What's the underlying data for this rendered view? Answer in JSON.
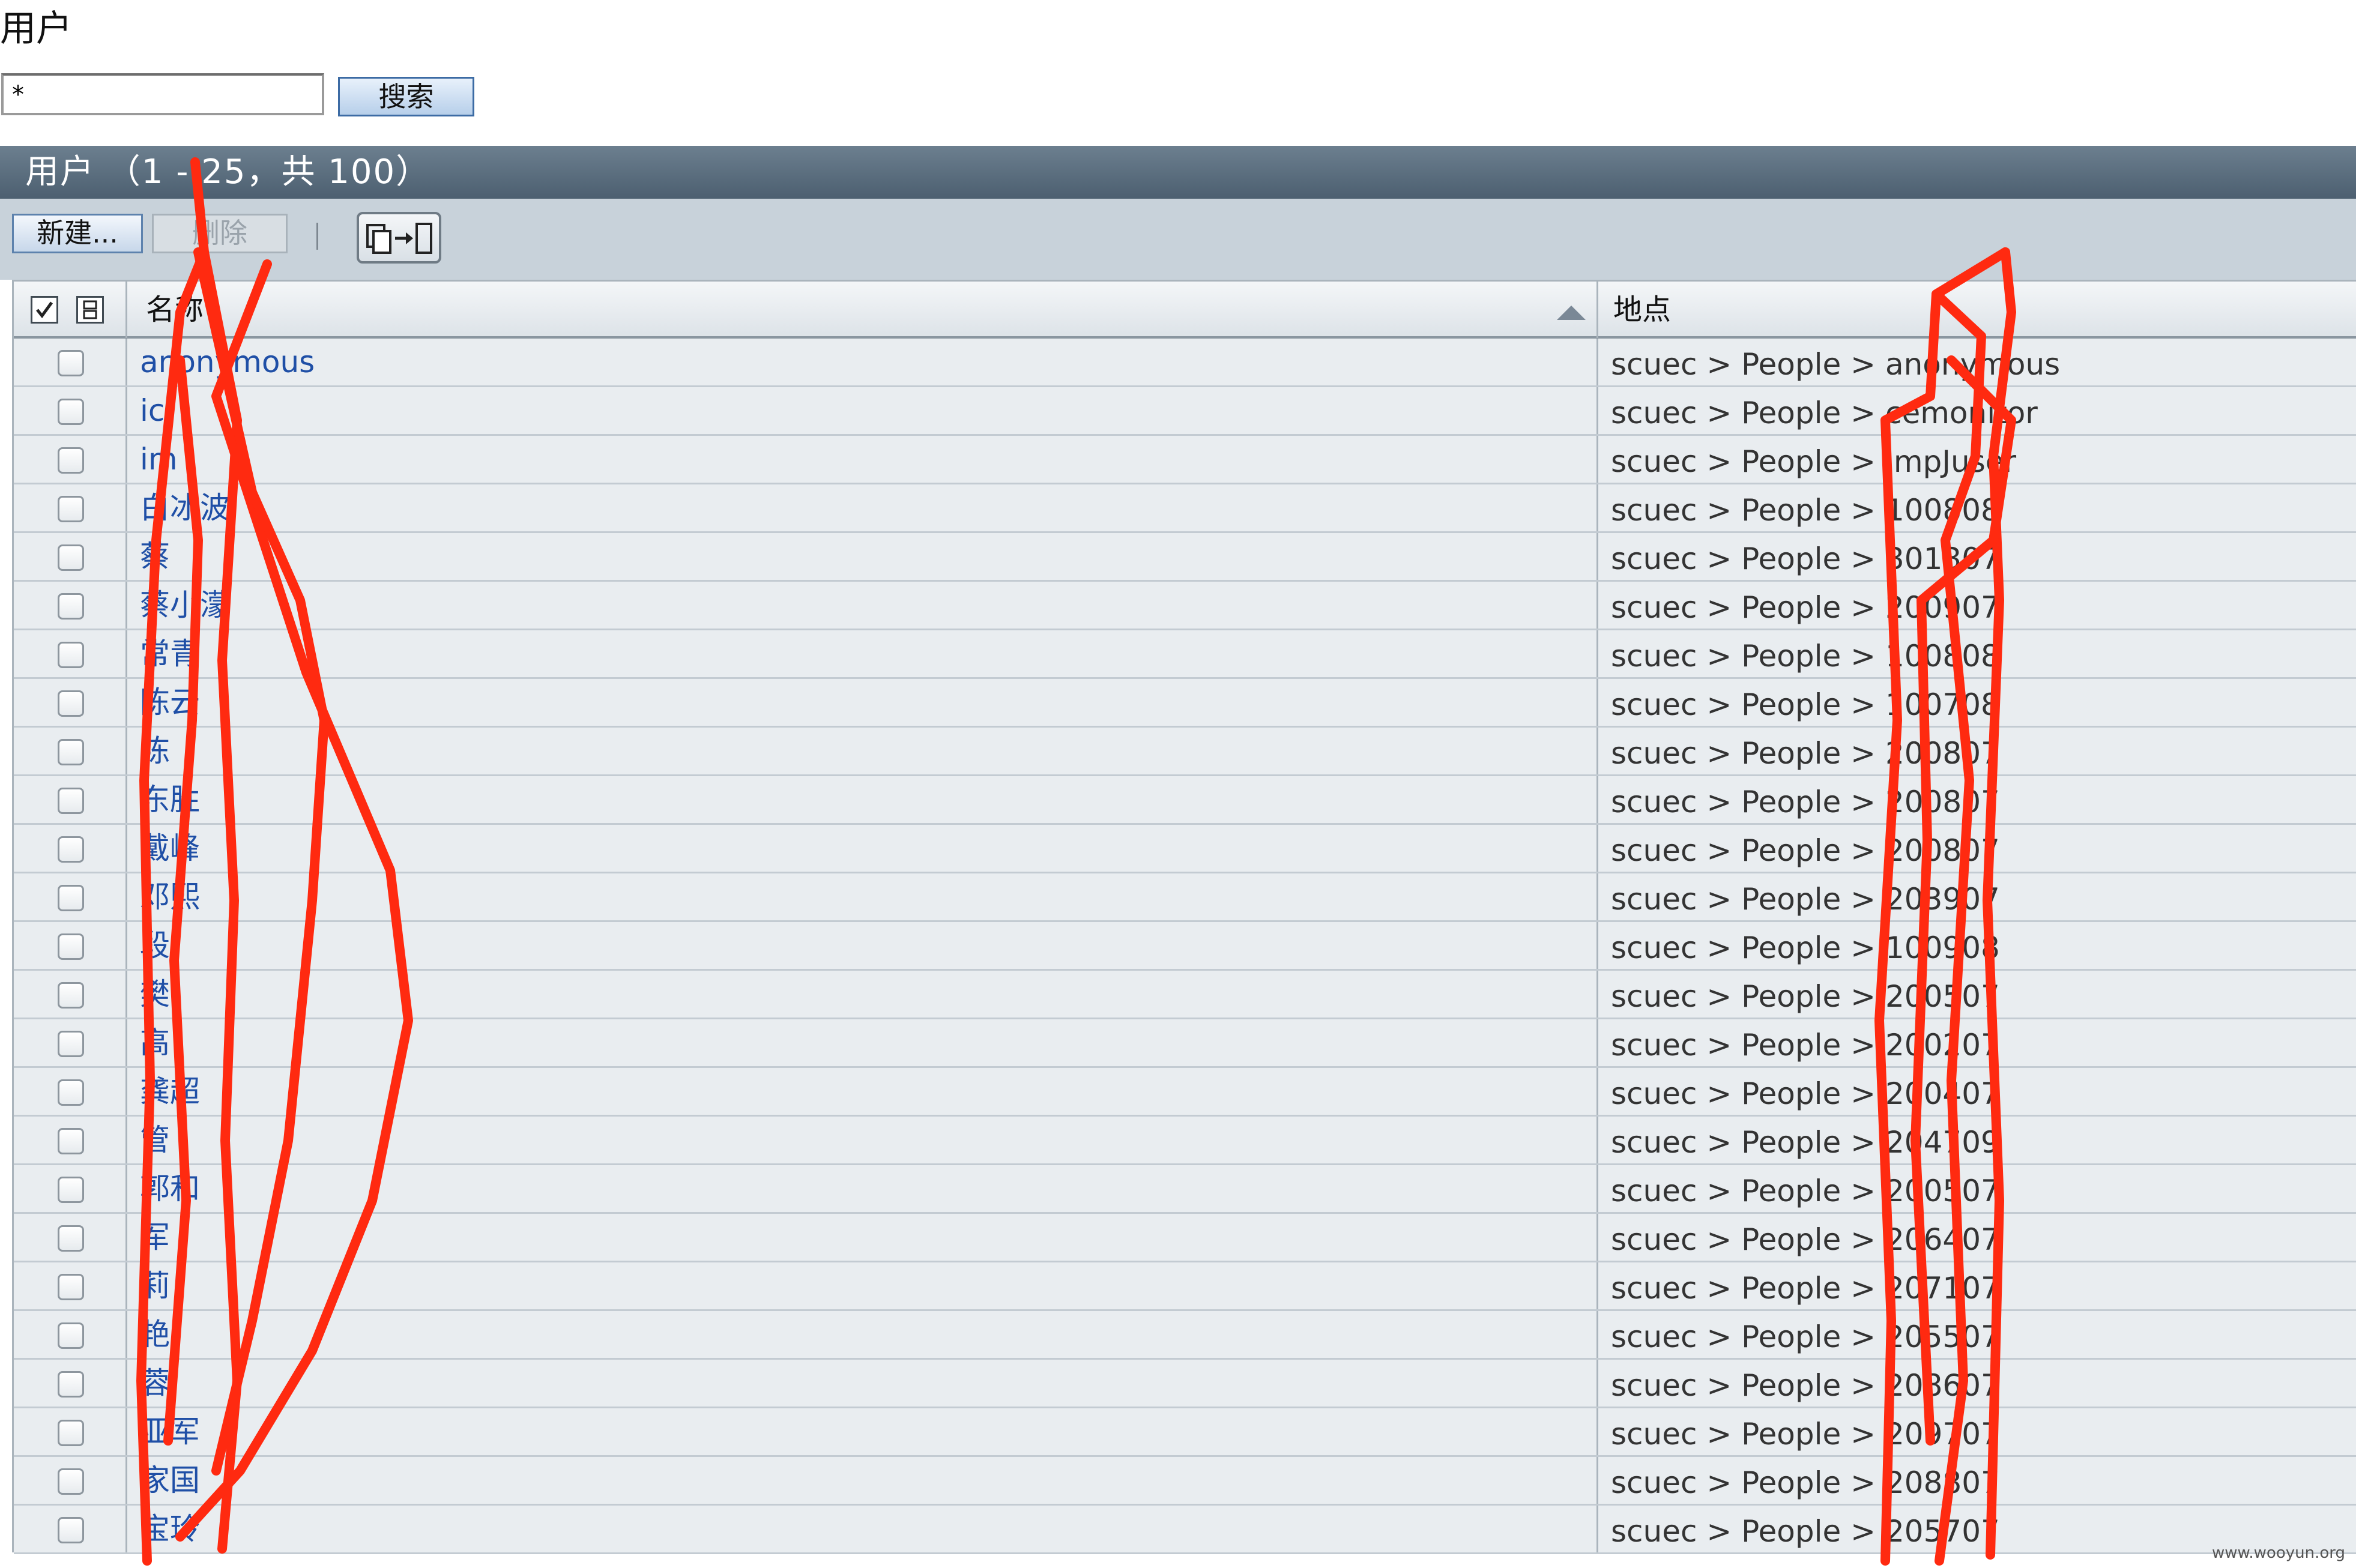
{
  "page": {
    "title": "用户"
  },
  "search": {
    "value": "*",
    "button_label": "搜索"
  },
  "panel": {
    "header": "用户 （1 - 25，共 100）"
  },
  "toolbar": {
    "new_label": "新建...",
    "delete_label": "删除",
    "move_icon": "copy-move-icon"
  },
  "grid": {
    "columns": {
      "name": "名称",
      "location": "地点"
    },
    "sort": {
      "column": "name",
      "direction": "ascending"
    },
    "rows": [
      {
        "name": "anonymous",
        "location": "scuec > People > anonymous"
      },
      {
        "name": "ic",
        "location": "scuec > People > cemonitor"
      },
      {
        "name": "im",
        "location": "scuec > People > impJuser"
      },
      {
        "name": "白冰波",
        "location": "scuec > People > 100808"
      },
      {
        "name": "蔡",
        "location": "scuec > People > 301307"
      },
      {
        "name": "蔡小濛",
        "location": "scuec > People > 200907"
      },
      {
        "name": "常青",
        "location": "scuec > People > 100808"
      },
      {
        "name": "陈云",
        "location": "scuec > People > 100708"
      },
      {
        "name": "陈",
        "location": "scuec > People > 200807"
      },
      {
        "name": "东胜",
        "location": "scuec > People > 200807"
      },
      {
        "name": "戴峰",
        "location": "scuec > People > 200807"
      },
      {
        "name": "邓熙",
        "location": "scuec > People > 203907"
      },
      {
        "name": "段",
        "location": "scuec > People > 100908"
      },
      {
        "name": "樊",
        "location": "scuec > People > 200507"
      },
      {
        "name": "高",
        "location": "scuec > People > 200207"
      },
      {
        "name": "龚超",
        "location": "scuec > People > 200407"
      },
      {
        "name": "管",
        "location": "scuec > People > 204709"
      },
      {
        "name": "郭和",
        "location": "scuec > People > 200507"
      },
      {
        "name": "军",
        "location": "scuec > People > 206407"
      },
      {
        "name": "莉",
        "location": "scuec > People > 207107"
      },
      {
        "name": "艳",
        "location": "scuec > People > 205507"
      },
      {
        "name": "蓉",
        "location": "scuec > People > 208607"
      },
      {
        "name": "亚军",
        "location": "scuec > People > 209707"
      },
      {
        "name": "家国",
        "location": "scuec > People > 208807"
      },
      {
        "name": "宝玲",
        "location": "scuec > People > 205707"
      }
    ]
  },
  "footer": {
    "watermark": "www.wooyun.org"
  },
  "colors": {
    "header_bar": "#56697a",
    "toolbar": "#c8d2da",
    "link": "#1f4fa6",
    "scribble": "#ff2a10"
  }
}
